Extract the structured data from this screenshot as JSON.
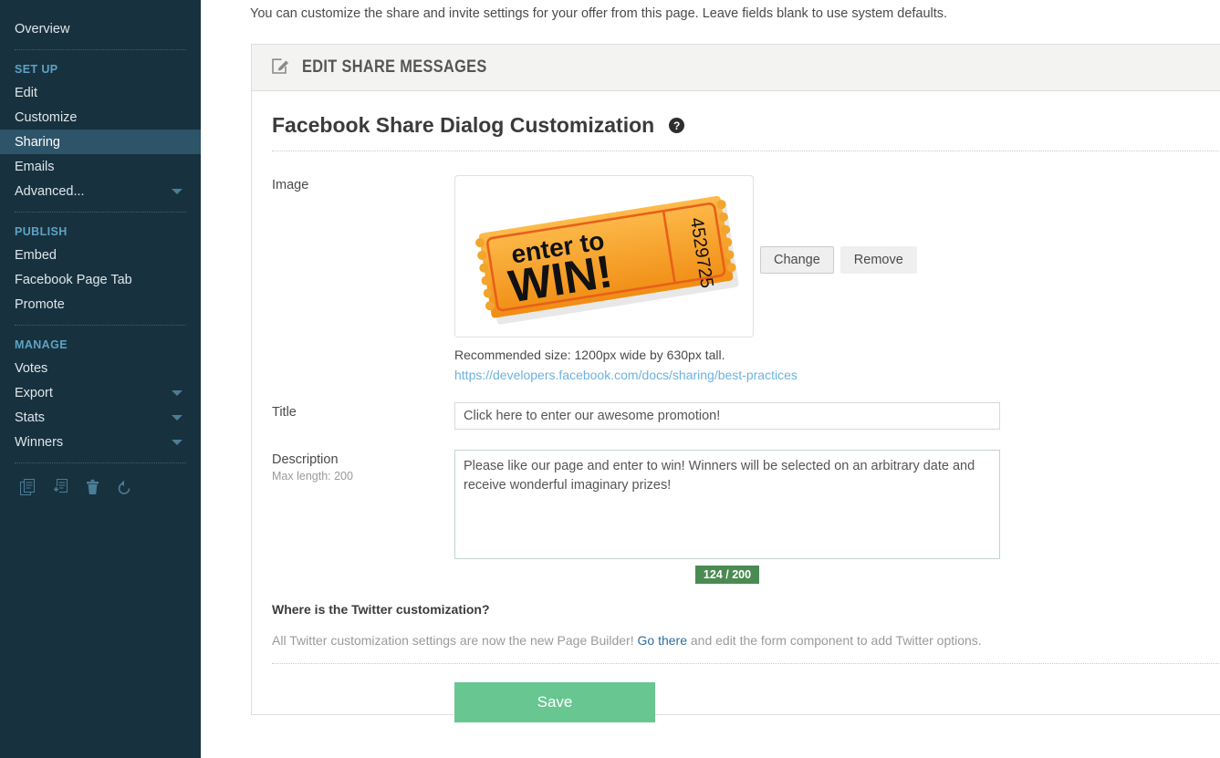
{
  "sidebar": {
    "top_items": [
      {
        "label": "Overview",
        "name": "overview",
        "active": false,
        "caret": false
      }
    ],
    "sections": [
      {
        "heading": "SET UP",
        "items": [
          {
            "label": "Edit",
            "name": "edit",
            "active": false,
            "caret": false
          },
          {
            "label": "Customize",
            "name": "customize",
            "active": false,
            "caret": false
          },
          {
            "label": "Sharing",
            "name": "sharing",
            "active": true,
            "caret": false
          },
          {
            "label": "Emails",
            "name": "emails",
            "active": false,
            "caret": false
          },
          {
            "label": "Advanced...",
            "name": "advanced",
            "active": false,
            "caret": true
          }
        ]
      },
      {
        "heading": "PUBLISH",
        "items": [
          {
            "label": "Embed",
            "name": "embed",
            "active": false,
            "caret": false
          },
          {
            "label": "Facebook Page Tab",
            "name": "facebook-page-tab",
            "active": false,
            "caret": false
          },
          {
            "label": "Promote",
            "name": "promote",
            "active": false,
            "caret": false
          }
        ]
      },
      {
        "heading": "MANAGE",
        "items": [
          {
            "label": "Votes",
            "name": "votes",
            "active": false,
            "caret": false
          },
          {
            "label": "Export",
            "name": "export",
            "active": false,
            "caret": true
          },
          {
            "label": "Stats",
            "name": "stats",
            "active": false,
            "caret": true
          },
          {
            "label": "Winners",
            "name": "winners",
            "active": false,
            "caret": true
          }
        ]
      }
    ],
    "tool_icons": [
      {
        "name": "copy-icon"
      },
      {
        "name": "duplicate-to-page-icon"
      },
      {
        "name": "delete-icon"
      },
      {
        "name": "reset-icon"
      }
    ]
  },
  "main": {
    "intro_text": "You can customize the share and invite settings for your offer from this page. Leave fields blank to use system defaults.",
    "panel_header": {
      "icon": "edit-pencil-icon",
      "title": "EDIT SHARE MESSAGES"
    },
    "section": {
      "title": "Facebook Share Dialog Customization",
      "help_icon": "question-mark-icon",
      "help_glyph": "?"
    },
    "image_field": {
      "label": "Image",
      "thumbnail_alt": "enter to WIN! ticket",
      "ticket_line1": "enter to",
      "ticket_line2": "WIN!",
      "ticket_number": "4529725",
      "change_label": "Change",
      "remove_label": "Remove",
      "recommendation": "Recommended size: 1200px wide by 630px tall.",
      "doc_link": "https://developers.facebook.com/docs/sharing/best-practices"
    },
    "title_field": {
      "label": "Title",
      "value": "Click here to enter our awesome promotion!"
    },
    "description_field": {
      "label": "Description",
      "sub_label": "Max length: 200",
      "value": "Please like our page and enter to win! Winners will be selected on an arbitrary date and receive wonderful imaginary prizes!",
      "counter": "124 / 200"
    },
    "twitter_note": {
      "question": "Where is the Twitter customization?",
      "answer_before": "All Twitter customization settings are now the new Page Builder! ",
      "link_label": "Go there",
      "answer_after": " and edit the form component to add Twitter options."
    },
    "save_label": "Save"
  },
  "colors": {
    "sidebar_bg": "#17313f",
    "sidebar_active": "#2d5468",
    "section_heading": "#5fa2c4",
    "save_green": "#68c691",
    "counter_green": "#4b8a52",
    "link_blue": "#6cb2e0",
    "go_there_blue": "#2d6f9e",
    "panel_head_bg": "#f3f3f1",
    "ticket_orange": "#f59a1e"
  }
}
